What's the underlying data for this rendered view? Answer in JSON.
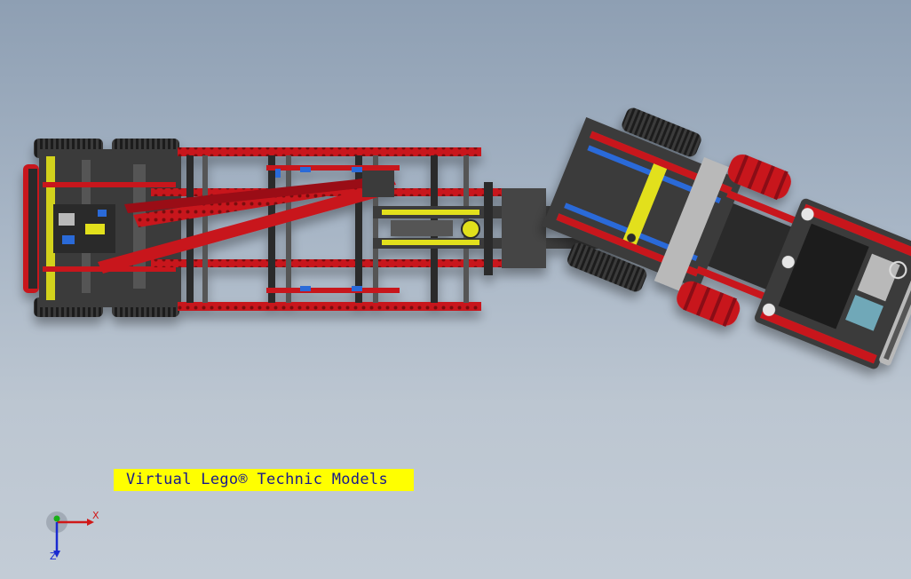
{
  "viewport": {
    "background_top": "#8e9fb3",
    "background_bottom": "#c3ccd6"
  },
  "model": {
    "icon": "lego-truck-chassis-model",
    "colors": {
      "frame_red": "#c8141e",
      "dark_gray": "#2a2a2a",
      "light_gray": "#b9b9b9",
      "yellow": "#e2e01c",
      "blue": "#2a6ad8",
      "tire_black": "#1c1c1c"
    }
  },
  "watermark": {
    "text": "Virtual Lego® Technic Models",
    "background": "#ffff00",
    "color": "#1a1a8c"
  },
  "triad": {
    "x_label": "X",
    "z_label": "Z",
    "x_color": "#d01818",
    "y_color": "#18b018",
    "z_color": "#1a2ad0"
  }
}
